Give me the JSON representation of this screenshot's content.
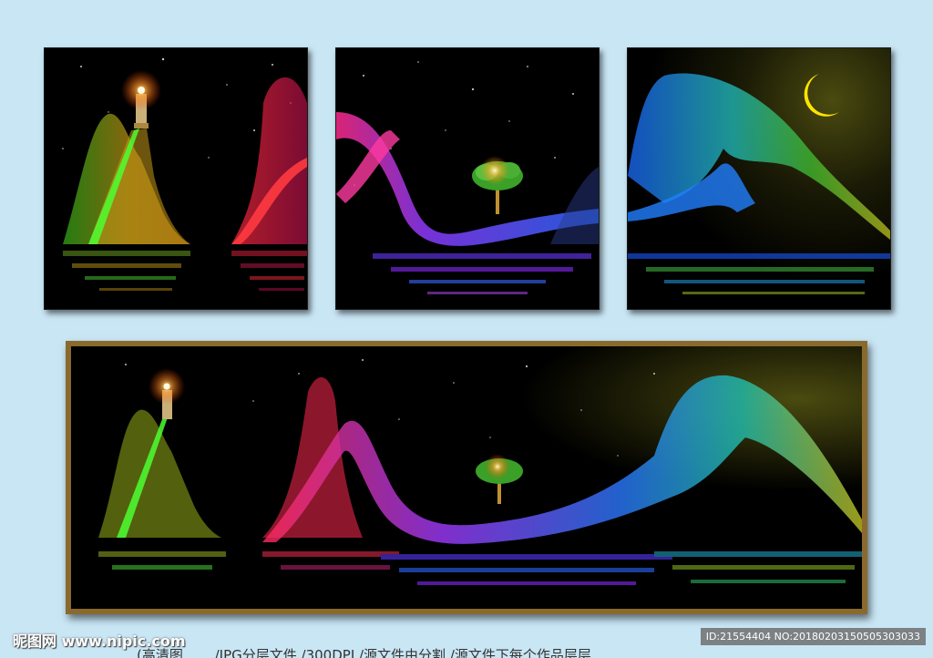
{
  "watermark": {
    "site_text": "昵图网 www.nipic.com",
    "id_text": "ID:21554404 NO:20180203150505303033"
  },
  "caption": "(高清图…… /JPG分层文件 /300DPI /源文件由分割 /源文件下每个作品层层"
}
